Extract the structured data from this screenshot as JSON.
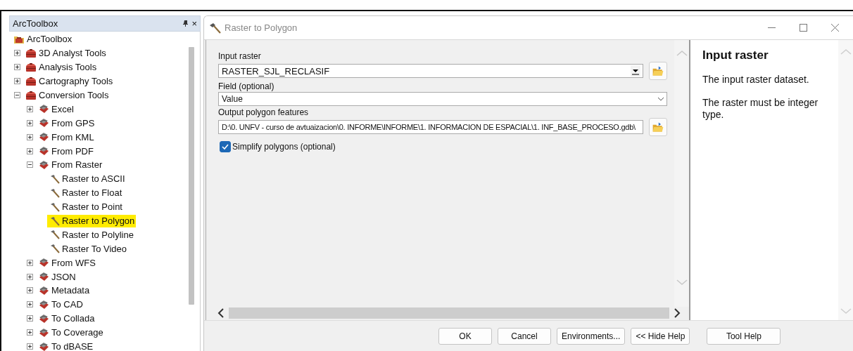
{
  "toolbox_panel": {
    "title": "ArcToolbox",
    "close_glyph": "×",
    "tree": [
      {
        "label": "ArcToolbox",
        "kind": "root",
        "children": [
          {
            "label": "3D Analyst Tools",
            "kind": "toolbox",
            "expanded": false
          },
          {
            "label": "Analysis Tools",
            "kind": "toolbox",
            "expanded": false
          },
          {
            "label": "Cartography Tools",
            "kind": "toolbox",
            "expanded": false
          },
          {
            "label": "Conversion Tools",
            "kind": "toolbox",
            "expanded": true,
            "children": [
              {
                "label": "Excel",
                "kind": "toolset",
                "expanded": false
              },
              {
                "label": "From GPS",
                "kind": "toolset",
                "expanded": false
              },
              {
                "label": "From KML",
                "kind": "toolset",
                "expanded": false
              },
              {
                "label": "From PDF",
                "kind": "toolset",
                "expanded": false
              },
              {
                "label": "From Raster",
                "kind": "toolset",
                "expanded": true,
                "children": [
                  {
                    "label": "Raster to ASCII",
                    "kind": "tool",
                    "selected": false
                  },
                  {
                    "label": "Raster to Float",
                    "kind": "tool",
                    "selected": false
                  },
                  {
                    "label": "Raster to Point",
                    "kind": "tool",
                    "selected": false
                  },
                  {
                    "label": "Raster to Polygon",
                    "kind": "tool",
                    "selected": true
                  },
                  {
                    "label": "Raster to Polyline",
                    "kind": "tool",
                    "selected": false
                  },
                  {
                    "label": "Raster To Video",
                    "kind": "tool",
                    "selected": false
                  }
                ]
              },
              {
                "label": "From WFS",
                "kind": "toolset",
                "expanded": false
              },
              {
                "label": "JSON",
                "kind": "toolset",
                "expanded": false
              },
              {
                "label": "Metadata",
                "kind": "toolset",
                "expanded": false
              },
              {
                "label": "To CAD",
                "kind": "toolset",
                "expanded": false
              },
              {
                "label": "To Collada",
                "kind": "toolset",
                "expanded": false
              },
              {
                "label": "To Coverage",
                "kind": "toolset",
                "expanded": false
              },
              {
                "label": "To dBASE",
                "kind": "toolset",
                "expanded": false
              }
            ]
          }
        ]
      }
    ]
  },
  "dialog": {
    "title": "Raster to Polygon",
    "parameters": [
      {
        "kind": "combo",
        "label": "Input raster",
        "value": "RASTER_SJL_RECLASIF"
      },
      {
        "kind": "dropdown",
        "label": "Field (optional)",
        "value": "Value"
      },
      {
        "kind": "path",
        "label": "Output polygon features",
        "value": "D:\\0. UNFV - curso de avtuaizacion\\0. INFORME\\INFORME\\1. INFORMACION DE ESPACIAL\\1. INF_BASE_PROCESO.gdb\\"
      },
      {
        "kind": "checkbox",
        "label": "Simplify polygons (optional)",
        "checked": true
      }
    ],
    "help": {
      "title": "Input raster",
      "paragraphs": [
        "The input raster dataset.",
        "The raster must be integer type."
      ]
    },
    "buttons": [
      "OK",
      "Cancel",
      "Environments...",
      "<< Hide Help",
      "Tool Help"
    ]
  }
}
